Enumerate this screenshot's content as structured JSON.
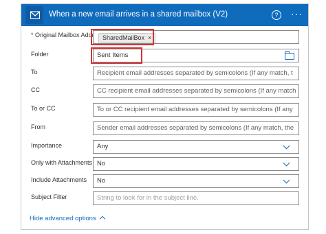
{
  "header": {
    "title": "When a new email arrives in a shared mailbox (V2)",
    "help_symbol": "?",
    "more_symbol": "···",
    "app_icon": "outlook-icon",
    "color": "#0f6cbd"
  },
  "fields": {
    "mailbox": {
      "label": "Original Mailbox Address",
      "required_mark": "*",
      "token": "SharedMailBox",
      "token_remove": "×"
    },
    "folder": {
      "label": "Folder",
      "value": "Sent Items"
    },
    "to": {
      "label": "To",
      "placeholder": "Recipient email addresses separated by semicolons (If any match, t"
    },
    "cc": {
      "label": "CC",
      "placeholder": "CC recipient email addresses separated by semicolons (If any match"
    },
    "to_or_cc": {
      "label": "To or CC",
      "placeholder": "To or CC recipient email addresses separated by semicolons (If any"
    },
    "from": {
      "label": "From",
      "placeholder": "Sender email addresses separated by semicolons (If any match, the"
    },
    "importance": {
      "label": "Importance",
      "value": "Any"
    },
    "only_attachments": {
      "label": "Only with Attachments",
      "value": "No"
    },
    "include_attachments": {
      "label": "Include Attachments",
      "value": "No"
    },
    "subject_filter": {
      "label": "Subject Filter",
      "placeholder": "String to look for in the subject line."
    }
  },
  "footer": {
    "hide_advanced": "Hide advanced options"
  },
  "highlight_color": "#d13438"
}
